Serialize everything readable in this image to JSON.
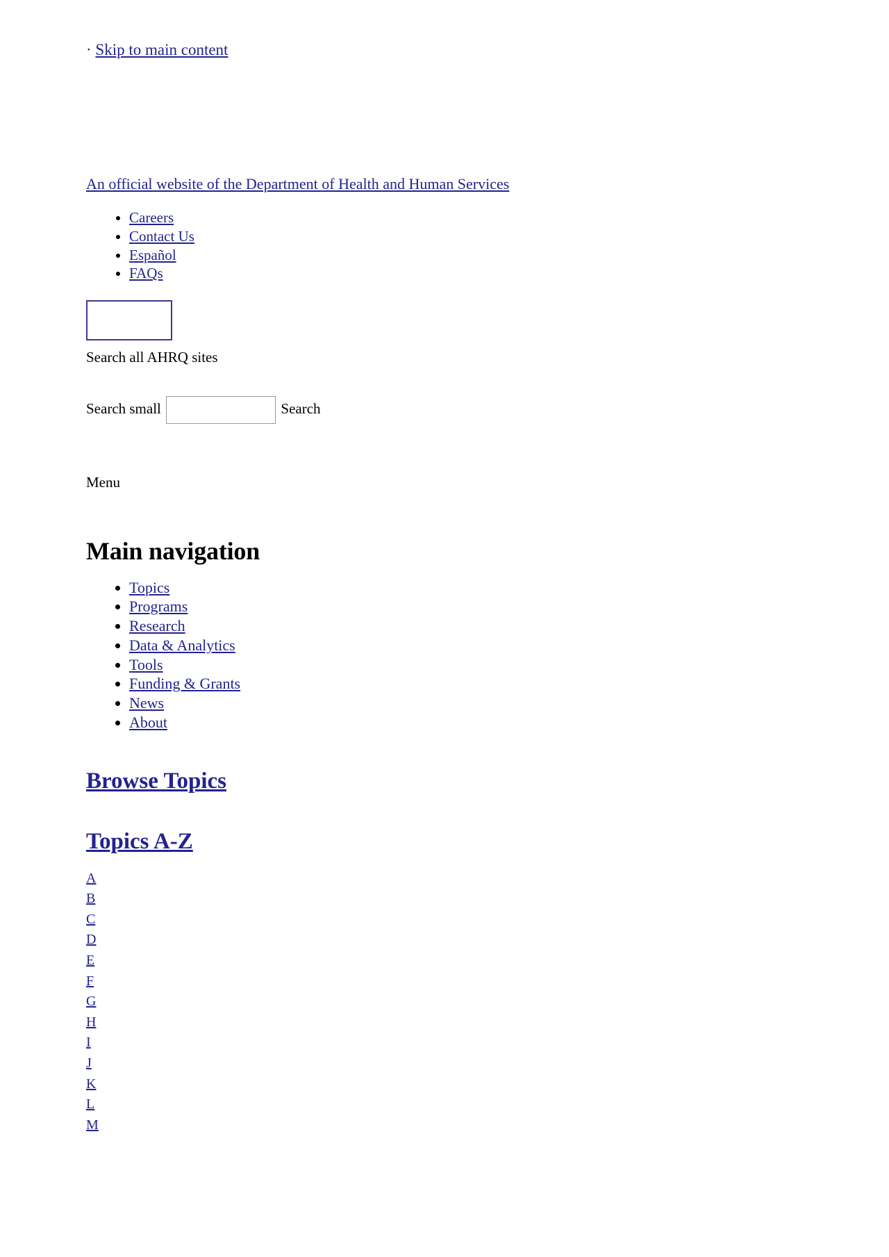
{
  "skip": {
    "bullet": "·",
    "label": "Skip to main content "
  },
  "banner": {
    "text": "An official website of the Department of Health and Human Services"
  },
  "utility_nav": {
    "items": [
      {
        "label": "Careers"
      },
      {
        "label": "Contact Us"
      },
      {
        "label": "Español"
      },
      {
        "label": "FAQs"
      }
    ]
  },
  "search": {
    "logo_box_name": "ahrq-logo-placeholder",
    "search_all_label": "Search all AHRQ sites",
    "small_label": "Search small",
    "input_value": "",
    "input_placeholder": "",
    "submit_label": "Search"
  },
  "menu": {
    "toggle_label": "Menu"
  },
  "main_navigation": {
    "heading": "Main navigation",
    "items": [
      {
        "label": "Topics"
      },
      {
        "label": "Programs"
      },
      {
        "label": "Research"
      },
      {
        "label": "Data & Analytics"
      },
      {
        "label": "Tools"
      },
      {
        "label": "Funding & Grants"
      },
      {
        "label": "News"
      },
      {
        "label": "About"
      }
    ]
  },
  "browse": {
    "browse_topics_label": "Browse Topics",
    "topics_az_label": "Topics A-Z",
    "letters": [
      "A",
      "B",
      "C",
      "D",
      "E",
      "F",
      "G",
      "H",
      "I",
      "J",
      "K",
      "L",
      "M"
    ]
  },
  "colors": {
    "link": "#23238e",
    "text": "#000000",
    "background": "#ffffff",
    "logo_box_border": "#3b3b8f",
    "input_border": "#9a9a9a"
  }
}
